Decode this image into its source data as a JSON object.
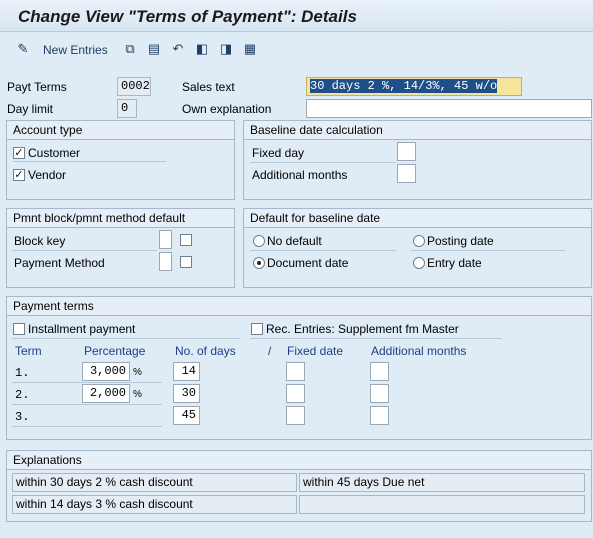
{
  "title": "Change View \"Terms of Payment\": Details",
  "toolbar": {
    "new_entries": "New Entries",
    "icons": [
      "glasses-edit-icon",
      "copy-icon",
      "delete-icon",
      "undo-icon",
      "prev-entry-icon",
      "next-entry-icon",
      "other-entry-icon"
    ]
  },
  "header": {
    "payt_terms_label": "Payt Terms",
    "payt_terms_value": "0002",
    "day_limit_label": "Day limit",
    "day_limit_value": "0",
    "sales_text_label": "Sales text",
    "sales_text_value": "30 days 2 %, 14/3%, 45 w/o",
    "own_expl_label": "Own explanation",
    "own_expl_value": ""
  },
  "account_type": {
    "title": "Account type",
    "customer_label": "Customer",
    "customer_checked": true,
    "vendor_label": "Vendor",
    "vendor_checked": true
  },
  "baseline_calc": {
    "title": "Baseline date calculation",
    "fixed_day_label": "Fixed day",
    "additional_months_label": "Additional months"
  },
  "pmnt_block": {
    "title": "Pmnt block/pmnt method default",
    "block_key_label": "Block key",
    "payment_method_label": "Payment Method"
  },
  "default_baseline": {
    "title": "Default for baseline date",
    "no_default": "No default",
    "posting_date": "Posting date",
    "document_date": "Document date",
    "entry_date": "Entry date",
    "selected": "Document date"
  },
  "payment_terms": {
    "title": "Payment terms",
    "installment_label": "Installment payment",
    "rec_entries_label": "Rec. Entries: Supplement fm Master",
    "headers": {
      "term": "Term",
      "percentage": "Percentage",
      "no_of_days": "No. of days",
      "slash": "/",
      "fixed_date": "Fixed date",
      "additional_months": "Additional months"
    },
    "percent_sign": "%",
    "rows": [
      {
        "term": "1.",
        "percentage": "3,000",
        "days": "14"
      },
      {
        "term": "2.",
        "percentage": "2,000",
        "days": "30"
      },
      {
        "term": "3.",
        "percentage": "",
        "days": "45"
      }
    ]
  },
  "explanations": {
    "title": "Explanations",
    "cells": [
      "within 30 days 2 % cash discount",
      "within 45 days Due net",
      "within 14 days 3 % cash discount",
      ""
    ]
  }
}
